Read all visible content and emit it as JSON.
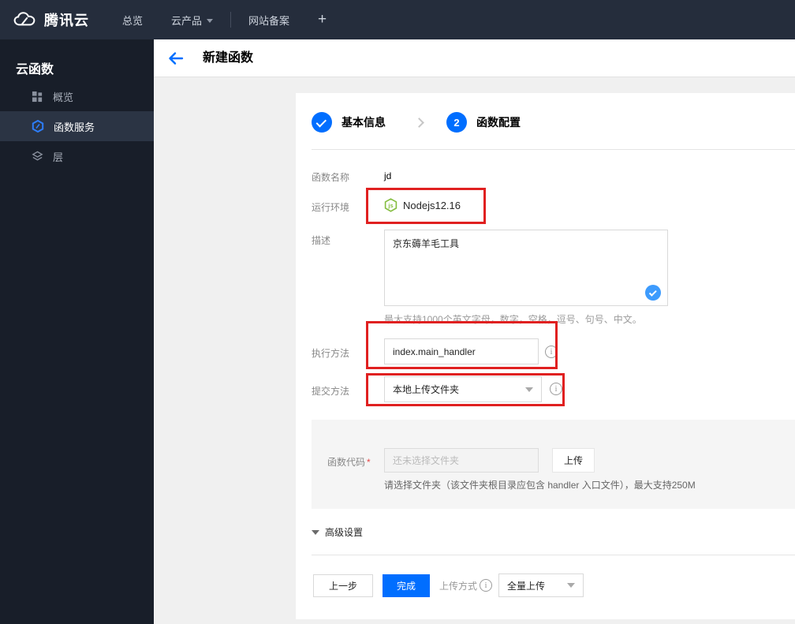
{
  "topbar": {
    "brand": "腾讯云",
    "nav_overview": "总览",
    "nav_products": "云产品",
    "nav_beian": "网站备案",
    "plus": "+"
  },
  "sidebar": {
    "title": "云函数",
    "items": [
      {
        "label": "概览",
        "icon": "grid-icon",
        "active": false
      },
      {
        "label": "函数服务",
        "icon": "hexagon-function-icon",
        "active": true
      },
      {
        "label": "层",
        "icon": "layers-icon",
        "active": false
      }
    ]
  },
  "header": {
    "title": "新建函数"
  },
  "steps": {
    "step1_label": "基本信息",
    "step2_num": "2",
    "step2_label": "函数配置"
  },
  "form": {
    "name": {
      "label": "函数名称",
      "value": "jd"
    },
    "runtime": {
      "label": "运行环境",
      "value": "Nodejs12.16"
    },
    "description": {
      "label": "描述",
      "value": "京东薅羊毛工具",
      "hint": "最大支持1000个英文字母，数字，空格，逗号、句号、中文。"
    },
    "handler": {
      "label": "执行方法",
      "value": "index.main_handler"
    },
    "submit_method": {
      "label": "提交方法",
      "value": "本地上传文件夹"
    },
    "code": {
      "label": "函数代码",
      "required_mark": "*",
      "placeholder": "还未选择文件夹",
      "upload_button": "上传",
      "hint": "请选择文件夹（该文件夹根目录应包含 handler 入口文件），最大支持250M"
    },
    "advanced_label": "高级设置"
  },
  "footer": {
    "prev": "上一步",
    "finish": "完成",
    "upload_mode_label": "上传方式",
    "upload_mode_value": "全量上传"
  },
  "colors": {
    "accent_blue": "#006eff",
    "check_blue": "#3d9bfd",
    "node_green": "#84bd3f",
    "annotation_red": "#e02020",
    "topbar_bg": "#252d3c",
    "sidebar_bg": "#181e29"
  }
}
